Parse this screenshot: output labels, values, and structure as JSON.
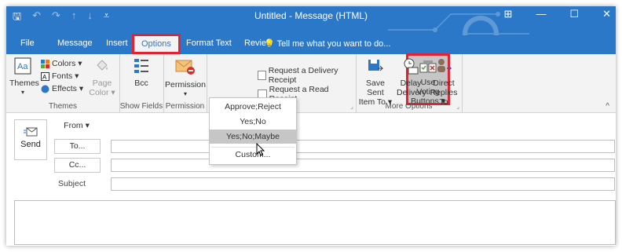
{
  "window": {
    "title": "Untitled - Message (HTML)"
  },
  "qat": {
    "save": "🖫",
    "undo": "↶",
    "redo": "↷",
    "up": "↑",
    "down": "↓",
    "customize": "⩡"
  },
  "controls": {
    "display": "⊞",
    "minimize": "—",
    "maximize": "☐",
    "close": "✕"
  },
  "tabs": [
    "File",
    "Message",
    "Insert",
    "Options",
    "Format Text",
    "Review"
  ],
  "active_tab": "Options",
  "tell_me": {
    "icon": "💡",
    "text": "Tell me what you want to do..."
  },
  "ribbon": {
    "themes": {
      "themes_label": "Themes",
      "colors": "Colors ▾",
      "fonts": "Fonts ▾",
      "effects": "Effects ▾",
      "page_color_1": "Page",
      "page_color_2": "Color ▾",
      "group": "Themes"
    },
    "show_fields": {
      "bcc": "Bcc",
      "group": "Show Fields"
    },
    "permission": {
      "label": "Permission",
      "group": "Permission"
    },
    "tracking": {
      "voting_1": "Use Voting",
      "voting_2": "Buttons ▾",
      "delivery": "Request a Delivery Receipt",
      "read": "Request a Read Receipt"
    },
    "more": {
      "save_sent_1": "Save Sent",
      "save_sent_2": "Item To ▾",
      "delay_1": "Delay",
      "delay_2": "Delivery",
      "direct_1": "Direct",
      "direct_2": "Replies To",
      "group": "More Options"
    }
  },
  "compose": {
    "send": "Send",
    "from": "From ▾",
    "to": "To...",
    "cc": "Cc...",
    "subject": "Subject"
  },
  "voting_menu": {
    "items": [
      "Approve;Reject",
      "Yes;No",
      "Yes;No;Maybe",
      "Custom..."
    ],
    "highlighted": "Yes;No;Maybe"
  },
  "colors": {
    "accent": "#2b78c9",
    "highlight_outline": "#e3232f"
  }
}
